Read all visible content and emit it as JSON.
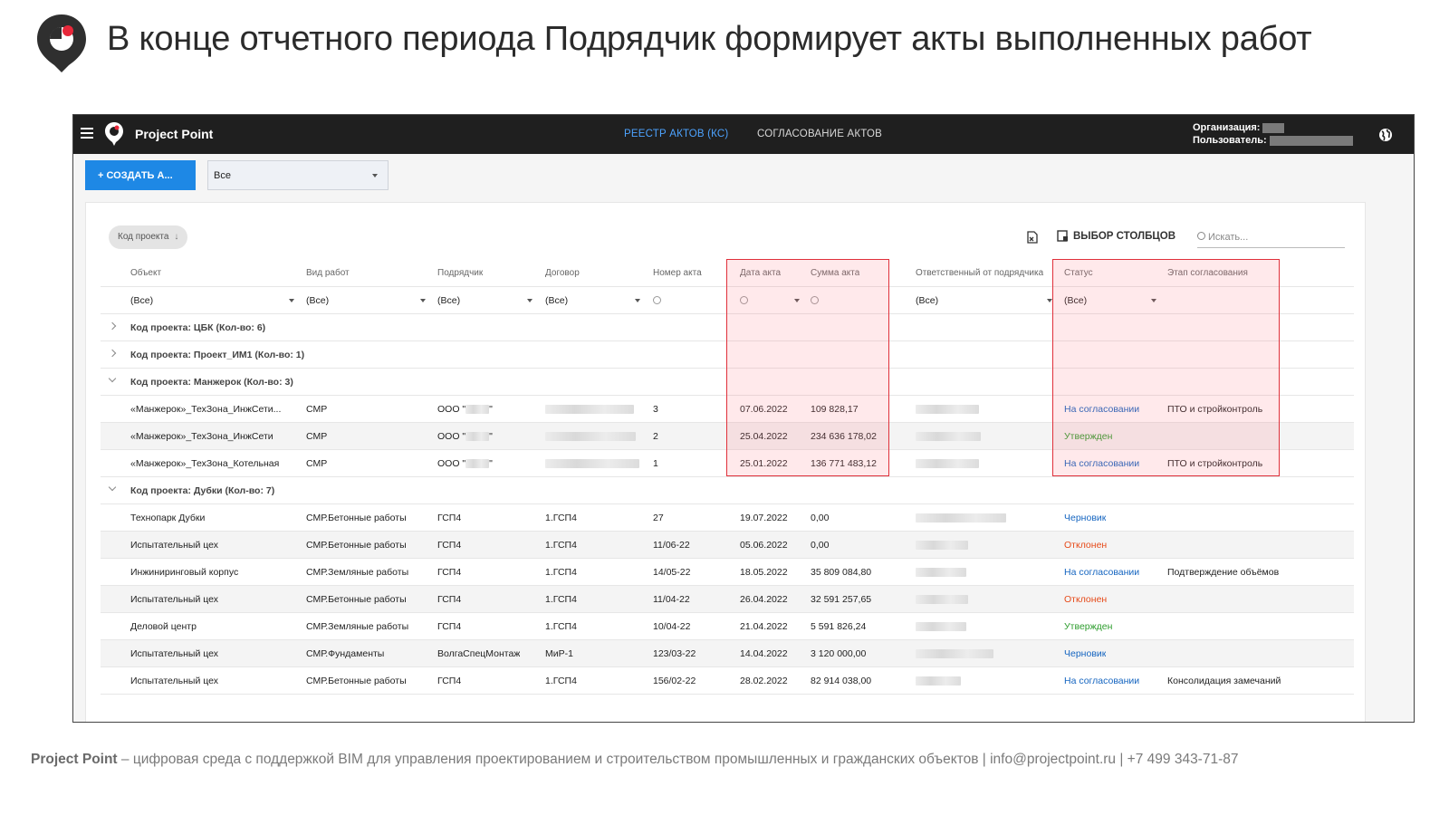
{
  "slide": {
    "title": "В конце отчетного периода Подрядчик формирует акты выполненных работ",
    "footer_brand": "Project Point",
    "footer_text": " – цифровая среда с поддержкой BIM для управления проектированием и строительством промышленных и гражданских объектов | info@projectpoint.ru | +7 499 343-71-87"
  },
  "app": {
    "brand": "Project Point",
    "nav": {
      "active": "РЕЕСТР АКТОВ (КС)",
      "inactive": "СОГЛАСОВАНИЕ АКТОВ"
    },
    "org_label": "Организация:",
    "user_label": "Пользователь:",
    "create_button": "+   СОЗДАТЬ А...",
    "filter_value": "Все",
    "group_chip": "Код проекта",
    "group_chip_arrow": "↓",
    "columns_button": "ВЫБОР СТОЛБЦОВ",
    "search_placeholder": "Искать...",
    "headers": [
      "Объект",
      "Вид работ",
      "Подрядчик",
      "Договор",
      "Номер акта",
      "Дата акта",
      "Сумма акта",
      "Ответственный от подрядчика",
      "Статус",
      "Этап согласования"
    ],
    "filter_all": "(Все)",
    "groups": [
      {
        "label": "Код проекта: ЦБК (Кол-во: 6)",
        "expanded": false
      },
      {
        "label": "Код проекта: Проект_ИМ1 (Кол-во: 1)",
        "expanded": false
      },
      {
        "label": "Код проекта: Манжерок (Кол-во: 3)",
        "expanded": true
      },
      {
        "label": "Код проекта: Дубки (Кол-во: 7)",
        "expanded": true
      }
    ],
    "rows_manzherok": [
      {
        "object": "«Манжерок»_ТехЗона_ИнжСети...",
        "work": "СМР",
        "contractor": "ООО \"",
        "contractor_end": "\"",
        "number": "3",
        "date": "07.06.2022",
        "sum": "109 828,17",
        "status": "На согласовании",
        "status_type": "review",
        "stage": "ПТО и стройконтроль"
      },
      {
        "object": "«Манжерок»_ТехЗона_ИнжСети",
        "work": "СМР",
        "contractor": "ООО \"",
        "contractor_end": "\"",
        "number": "2",
        "date": "25.04.2022",
        "sum": "234 636 178,02",
        "status": "Утвержден",
        "status_type": "approved",
        "stage": ""
      },
      {
        "object": "«Манжерок»_ТехЗона_Котельная",
        "work": "СМР",
        "contractor": "ООО \"",
        "contractor_end": "\"",
        "number": "1",
        "date": "25.01.2022",
        "sum": "136 771 483,12",
        "status": "На согласовании",
        "status_type": "review",
        "stage": "ПТО и стройконтроль"
      }
    ],
    "rows_dubki": [
      {
        "object": "Технопарк Дубки",
        "work": "СМР.Бетонные работы",
        "contractor": "ГСП4",
        "contract": "1.ГСП4",
        "number": "27",
        "date": "19.07.2022",
        "sum": "0,00",
        "status": "Черновик",
        "status_type": "draft",
        "stage": ""
      },
      {
        "object": "Испытательный цех",
        "work": "СМР.Бетонные работы",
        "contractor": "ГСП4",
        "contract": "1.ГСП4",
        "number": "11/06-22",
        "date": "05.06.2022",
        "sum": "0,00",
        "status": "Отклонен",
        "status_type": "rejected",
        "stage": ""
      },
      {
        "object": "Инжиниринговый корпус",
        "work": "СМР.Земляные работы",
        "contractor": "ГСП4",
        "contract": "1.ГСП4",
        "number": "14/05-22",
        "date": "18.05.2022",
        "sum": "35 809 084,80",
        "status": "На согласовании",
        "status_type": "review",
        "stage": "Подтверждение объёмов"
      },
      {
        "object": "Испытательный цех",
        "work": "СМР.Бетонные работы",
        "contractor": "ГСП4",
        "contract": "1.ГСП4",
        "number": "11/04-22",
        "date": "26.04.2022",
        "sum": "32 591 257,65",
        "status": "Отклонен",
        "status_type": "rejected",
        "stage": ""
      },
      {
        "object": "Деловой центр",
        "work": "СМР.Земляные работы",
        "contractor": "ГСП4",
        "contract": "1.ГСП4",
        "number": "10/04-22",
        "date": "21.04.2022",
        "sum": "5 591 826,24",
        "status": "Утвержден",
        "status_type": "approved",
        "stage": ""
      },
      {
        "object": "Испытательный цех",
        "work": "СМР.Фундаменты",
        "contractor": "ВолгаСпецМонтаж",
        "contract": "МиР-1",
        "number": "123/03-22",
        "date": "14.04.2022",
        "sum": "3 120 000,00",
        "status": "Черновик",
        "status_type": "draft",
        "stage": ""
      },
      {
        "object": "Испытательный цех",
        "work": "СМР.Бетонные работы",
        "contractor": "ГСП4",
        "contract": "1.ГСП4",
        "number": "156/02-22",
        "date": "28.02.2022",
        "sum": "82 914 038,00",
        "status": "На согласовании",
        "status_type": "review",
        "stage": "Консолидация замечаний"
      }
    ],
    "colors": {
      "accent": "#1e88e5",
      "nav_active": "#4da3ff",
      "highlight": "#e0303a",
      "status_review": "#1565c0",
      "status_approved": "#2e9d2e",
      "status_rejected": "#e64a19"
    }
  }
}
